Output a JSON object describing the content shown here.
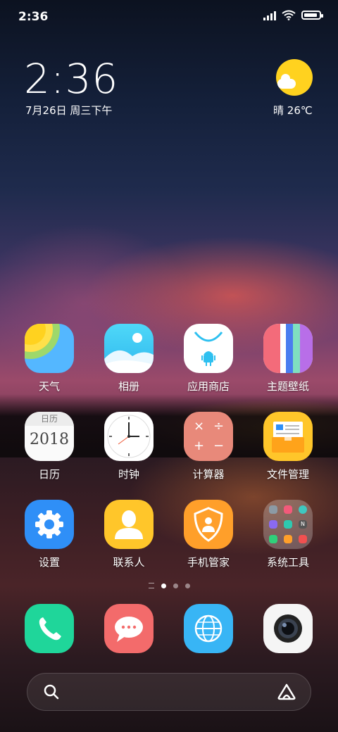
{
  "status_bar": {
    "time": "2:36",
    "battery_level": 0.9
  },
  "clock_widget": {
    "time": "2:36",
    "date": "7月26日 周三下午"
  },
  "weather_widget": {
    "condition": "晴",
    "temperature": "26℃",
    "icon": "sunny-cloud-icon"
  },
  "apps": [
    {
      "label": "天气",
      "icon": "weather-icon"
    },
    {
      "label": "相册",
      "icon": "gallery-icon"
    },
    {
      "label": "应用商店",
      "icon": "app-store-icon"
    },
    {
      "label": "主题壁纸",
      "icon": "themes-icon"
    },
    {
      "label": "日历",
      "icon": "calendar-icon",
      "icon_text_top": "日历",
      "icon_text_main": "2018"
    },
    {
      "label": "时钟",
      "icon": "clock-icon"
    },
    {
      "label": "计算器",
      "icon": "calculator-icon",
      "symbols": [
        "×",
        "÷",
        "+",
        "−"
      ]
    },
    {
      "label": "文件管理",
      "icon": "file-manager-icon"
    },
    {
      "label": "设置",
      "icon": "settings-icon"
    },
    {
      "label": "联系人",
      "icon": "contacts-icon"
    },
    {
      "label": "手机管家",
      "icon": "security-icon"
    },
    {
      "label": "系统工具",
      "icon": "folder-icon",
      "folder_badge": "N"
    }
  ],
  "page_indicator": {
    "pages": 3,
    "current": 1
  },
  "dock": [
    {
      "name": "phone",
      "icon": "phone-icon"
    },
    {
      "name": "messages",
      "icon": "message-icon"
    },
    {
      "name": "browser",
      "icon": "globe-icon"
    },
    {
      "name": "camera",
      "icon": "camera-icon"
    }
  ],
  "search_bar": {
    "left_icon": "search-icon",
    "right_icon": "assistant-icon"
  },
  "colors": {
    "weather_sun": "#ffd21f",
    "gallery_bg": "#3fd3f5",
    "settings_bg": "#2f8ff7",
    "contacts_bg": "#ffc62a",
    "security_bg": "#ff9f2a",
    "calculator_bg": "#e8897a",
    "phone_bg": "#1fd69a",
    "message_bg": "#f36b6b",
    "browser_bg": "#38b5f5"
  }
}
